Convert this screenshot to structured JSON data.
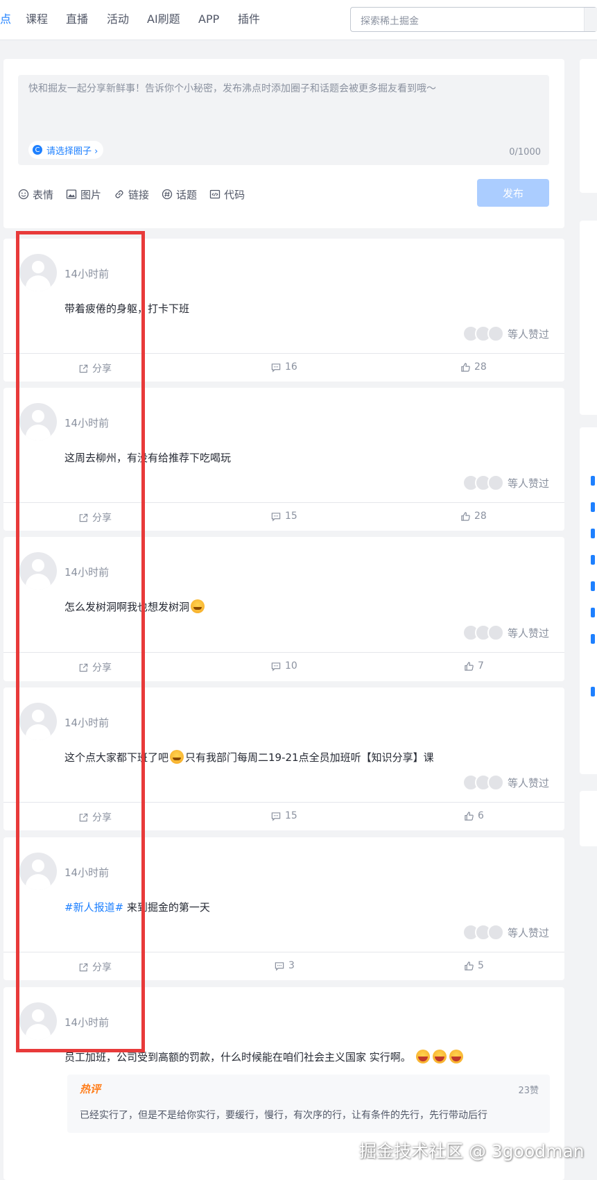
{
  "nav": {
    "items": [
      "点",
      "课程",
      "直播",
      "活动",
      "AI刷题",
      "APP",
      "插件"
    ],
    "search_placeholder": "探索稀土掘金"
  },
  "composer": {
    "placeholder": "快和掘友一起分享新鲜事！告诉你个小秘密，发布沸点时添加圈子和话题会被更多掘友看到哦～",
    "circle_select": "请选择圈子 ›",
    "counter": "0/1000",
    "tools": [
      "表情",
      "图片",
      "链接",
      "话题",
      "代码"
    ],
    "publish": "发布"
  },
  "posts": [
    {
      "time": "14小时前",
      "content": "带着疲倦的身躯，打卡下班",
      "likers": "等人赞过",
      "share": "分享",
      "comments": "16",
      "likes": "28"
    },
    {
      "time": "14小时前",
      "content": "这周去柳州，有没有给推荐下吃喝玩",
      "likers": "等人赞过",
      "share": "分享",
      "comments": "15",
      "likes": "28"
    },
    {
      "time": "14小时前",
      "content": "怎么发树洞啊我也想发树洞",
      "likers": "等人赞过",
      "share": "分享",
      "comments": "10",
      "likes": "7"
    },
    {
      "time": "14小时前",
      "content_a": "这个点大家都下班了吧",
      "content_b": "只有我部门每周二19-21点全员加班听【知识分享】课",
      "likers": "等人赞过",
      "share": "分享",
      "comments": "15",
      "likes": "6"
    },
    {
      "time": "14小时前",
      "tag": "#新人报道#",
      "content": " 来到掘金的第一天",
      "likers": "等人赞过",
      "share": "分享",
      "comments": "3",
      "likes": "5"
    },
    {
      "time": "14小时前",
      "content": "员工加班，公司受到高额的罚款，什么时候能在咱们社会主义国家 实行啊。",
      "hot_badge": "热评",
      "hot_likes": "23赞",
      "hot_text": "已经实行了，但是不是给你实行，要缓行，慢行，有次序的行，让有条件的先行，先行带动后行"
    }
  ],
  "watermark": "掘金技术社区 @ 3goodman",
  "colors": {
    "accent": "#1e80ff",
    "highlight_box": "#e83a3a",
    "publish_disabled": "#abcdff"
  }
}
